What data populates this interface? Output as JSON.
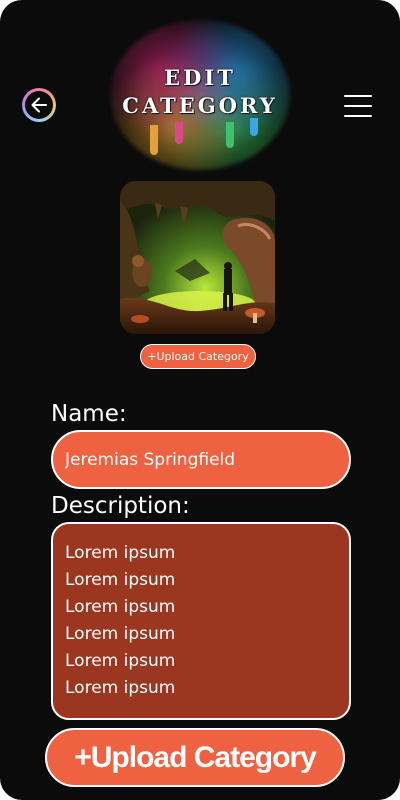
{
  "header": {
    "title_line1": "EDIT",
    "title_line2": "CATEGORY"
  },
  "image": {
    "upload_label": "+Upload Category"
  },
  "form": {
    "name_label": "Name:",
    "name_value": "Jeremias Springfield",
    "description_label": "Description:",
    "description_lines": [
      "Lorem ipsum",
      "Lorem ipsum",
      "Lorem ipsum",
      "Lorem ipsum",
      "Lorem ipsum",
      "Lorem ipsum"
    ]
  },
  "submit": {
    "label": "+Upload Category"
  },
  "colors": {
    "background": "#0b0b0b",
    "accent": "#ee6242",
    "accent_dark": "#9b3720",
    "text": "#ffffff"
  },
  "icons": {
    "back": "arrow-left-circle-icon",
    "menu": "hamburger-menu-icon"
  }
}
